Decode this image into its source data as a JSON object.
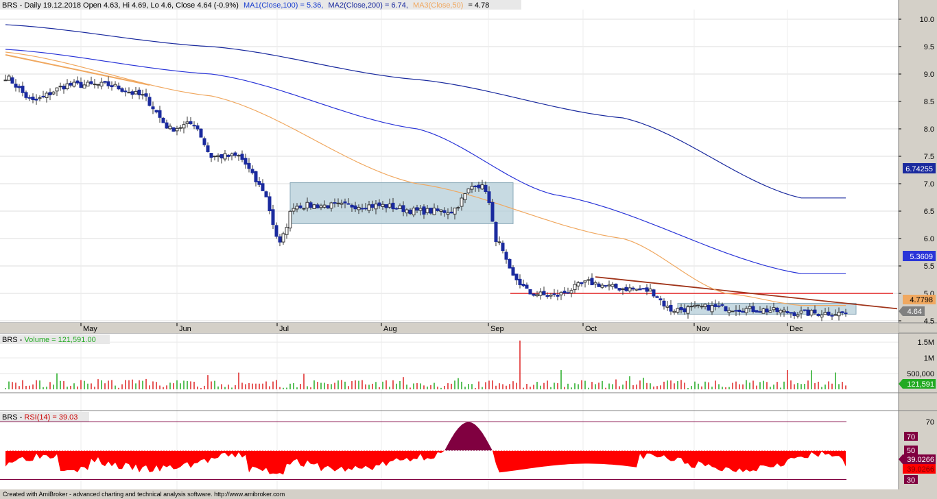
{
  "title_bar": {
    "prefix": "BRS - Daily 19.12.2018 Open 4.63, Hi 4.69, Lo 4.6, Close 4.64 (-0.9%)",
    "ma1": "MA1(Close,100) = 5.36,",
    "ma2": "MA2(Close,200) = 6.74,",
    "ma3": "MA3(Close,50)",
    "ma3_val": "= 4.78"
  },
  "volume_title": {
    "prefix": "BRS - ",
    "label": "Volume = 121,591.00"
  },
  "rsi_title": {
    "prefix": "BRS - ",
    "label": "RSI(14) = 39.03"
  },
  "footer": "Created with AmiBroker - advanced charting and technical analysis software. http://www.amibroker.com",
  "colors": {
    "up_candle": "#ffffff",
    "down_candle": "#1a2a9e",
    "ma50": "#f0a860",
    "ma100": "#2a35d8",
    "ma200": "#1a2a9e",
    "trendline": "#a0341a",
    "support": "#e02020",
    "box": "#b4cdd8",
    "volume_up": "#22aa22",
    "volume_down": "#dd2222",
    "rsi_fill": "#ff0000",
    "rsi_ob": "#800040"
  },
  "price_badges": {
    "ma200": "6.74255",
    "ma100": "5.3609",
    "ma50": "4.7798",
    "close": "4.64"
  },
  "volume_badge": "121,591",
  "rsi_badges": {
    "rsi": "39.0266",
    "rsi_dup": "39.0266",
    "ob": "70",
    "mid": "50",
    "os": "30"
  },
  "chart_data": [
    {
      "type": "candlestick",
      "symbol": "BRS",
      "timeframe": "Daily",
      "x_labels": [
        "May",
        "Jun",
        "Jul",
        "Aug",
        "Sep",
        "Oct",
        "Nov",
        "Dec"
      ],
      "y_ticks": [
        "10.0",
        "9.5",
        "9.0",
        "8.5",
        "8.0",
        "7.5",
        "7.0",
        "6.5",
        "6.0",
        "5.5",
        "5.0",
        "4.5"
      ],
      "ylim": [
        4.45,
        10.25
      ],
      "approx_close_path": [
        [
          0,
          8.95
        ],
        [
          8,
          8.5
        ],
        [
          18,
          8.8
        ],
        [
          30,
          8.8
        ],
        [
          40,
          8.6
        ],
        [
          48,
          8.0
        ],
        [
          55,
          8.1
        ],
        [
          60,
          7.5
        ],
        [
          68,
          7.5
        ],
        [
          75,
          6.9
        ],
        [
          80,
          5.9
        ],
        [
          84,
          6.6
        ],
        [
          95,
          6.6
        ],
        [
          110,
          6.6
        ],
        [
          120,
          6.5
        ],
        [
          130,
          6.5
        ],
        [
          137,
          7.0
        ],
        [
          140,
          6.9
        ],
        [
          143,
          6.0
        ],
        [
          148,
          5.3
        ],
        [
          153,
          5.0
        ],
        [
          160,
          4.95
        ],
        [
          170,
          5.2
        ],
        [
          178,
          5.1
        ],
        [
          188,
          5.05
        ],
        [
          194,
          4.7
        ],
        [
          205,
          4.75
        ],
        [
          220,
          4.7
        ],
        [
          232,
          4.64
        ]
      ],
      "series": [
        {
          "name": "MA3(Close,50)",
          "approx_values": [
            [
              0,
              9.4
            ],
            [
              60,
              8.6
            ],
            [
              120,
              7.0
            ],
            [
              180,
              6.0
            ],
            [
              210,
              5.0
            ],
            [
              232,
              4.78
            ]
          ]
        },
        {
          "name": "MA1(Close,100)",
          "approx_values": [
            [
              0,
              9.45
            ],
            [
              60,
              9.0
            ],
            [
              120,
              8.0
            ],
            [
              160,
              6.8
            ],
            [
              232,
              5.36
            ]
          ]
        },
        {
          "name": "MA2(Close,200)",
          "approx_values": [
            [
              0,
              9.9
            ],
            [
              60,
              9.5
            ],
            [
              120,
              8.9
            ],
            [
              180,
              8.2
            ],
            [
              232,
              6.74
            ]
          ]
        }
      ],
      "annotations": {
        "support_level": 5.0,
        "consolidation_box": {
          "from_idx": 83,
          "to_idx": 148,
          "low": 6.27,
          "high": 7.02
        },
        "late_box": {
          "from_idx": 196,
          "to_idx": 248,
          "low": 4.62,
          "high": 4.82
        },
        "early_downtrend": {
          "from": [
            0,
            9.35
          ],
          "to": [
            42,
            8.8
          ]
        },
        "downtrend_line": {
          "from": [
            172,
            5.3
          ],
          "to": [
            260,
            4.72
          ]
        }
      }
    },
    {
      "type": "bar",
      "name": "Volume",
      "y_ticks": [
        "1.5M",
        "1M",
        "500,000"
      ],
      "ylim": [
        0,
        1600000
      ],
      "last_value": 121591,
      "peak_value": 1550000
    },
    {
      "type": "area",
      "name": "RSI(14)",
      "y_ticks": [
        "70"
      ],
      "ylim": [
        25,
        75
      ],
      "levels": [
        70,
        50,
        30
      ],
      "last_value": 39.03
    }
  ]
}
